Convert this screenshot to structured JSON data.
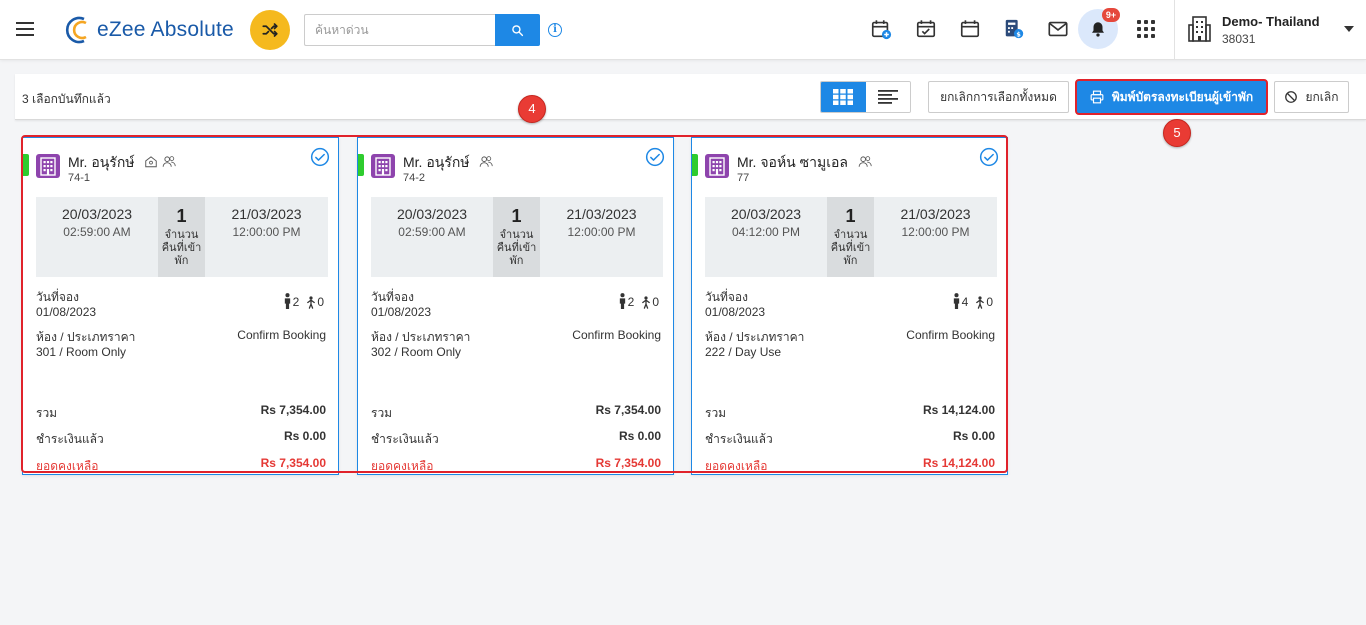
{
  "header": {
    "app_name": "eZee Absolute",
    "search_placeholder": "ค้นหาด่วน",
    "notification_badge": "9+",
    "property_name": "Demo- Thailand",
    "property_id": "38031"
  },
  "actionbar": {
    "selected_text": "3 เลือกบันทึกแล้ว",
    "deselect_all_label": "ยกเลิกการเลือกทั้งหมด",
    "print_label": "พิมพ์บัตรลงทะเบียนผู้เข้าพัก",
    "cancel_label": "ยกเลิก"
  },
  "callouts": {
    "step4": "4",
    "step5": "5"
  },
  "labels": {
    "nights": "จำนวนคืนที่เข้าพัก",
    "booking_date": "วันที่จอง",
    "room_rate": "ห้อง / ประเภทราคา",
    "total": "รวม",
    "paid": "ชำระเงินแล้ว",
    "balance": "ยอดคงเหลือ"
  },
  "cards": [
    {
      "guest_name": "Mr. อนุรักษ์",
      "room_code": "74-1",
      "arrival_date": "20/03/2023",
      "arrival_time": "02:59:00 AM",
      "nights": "1",
      "departure_date": "21/03/2023",
      "departure_time": "12:00:00 PM",
      "adults": "2",
      "children": "0",
      "booking_date": "01/08/2023",
      "status": "Confirm Booking",
      "room_rate": "301 / Room Only",
      "total": "Rs 7,354.00",
      "paid": "Rs 0.00",
      "balance": "Rs 7,354.00"
    },
    {
      "guest_name": "Mr. อนุรักษ์",
      "room_code": "74-2",
      "arrival_date": "20/03/2023",
      "arrival_time": "02:59:00 AM",
      "nights": "1",
      "departure_date": "21/03/2023",
      "departure_time": "12:00:00 PM",
      "adults": "2",
      "children": "0",
      "booking_date": "01/08/2023",
      "status": "Confirm Booking",
      "room_rate": "302 / Room Only",
      "total": "Rs 7,354.00",
      "paid": "Rs 0.00",
      "balance": "Rs 7,354.00"
    },
    {
      "guest_name": "Mr. จอห์น ซามูเอล",
      "room_code": "77",
      "arrival_date": "20/03/2023",
      "arrival_time": "04:12:00 PM",
      "nights": "1",
      "departure_date": "21/03/2023",
      "departure_time": "12:00:00 PM",
      "adults": "4",
      "children": "0",
      "booking_date": "01/08/2023",
      "status": "Confirm Booking",
      "room_rate": "222 / Day Use",
      "total": "Rs 14,124.00",
      "paid": "Rs 0.00",
      "balance": "Rs 14,124.00"
    }
  ]
}
